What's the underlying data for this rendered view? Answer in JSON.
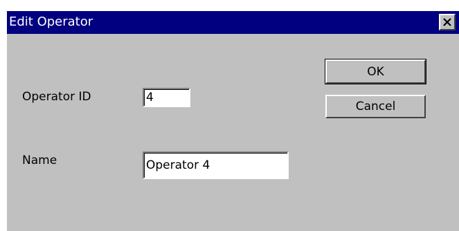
{
  "window": {
    "title": "Edit Operator",
    "close_icon": "close-icon"
  },
  "form": {
    "operator_id_label": "Operator ID",
    "operator_id_value": "4",
    "name_label": "Name",
    "name_value": "Operator 4"
  },
  "buttons": {
    "ok_label": "OK",
    "cancel_label": "Cancel"
  },
  "colors": {
    "titlebar": "#000080",
    "face": "#c0c0c0"
  }
}
